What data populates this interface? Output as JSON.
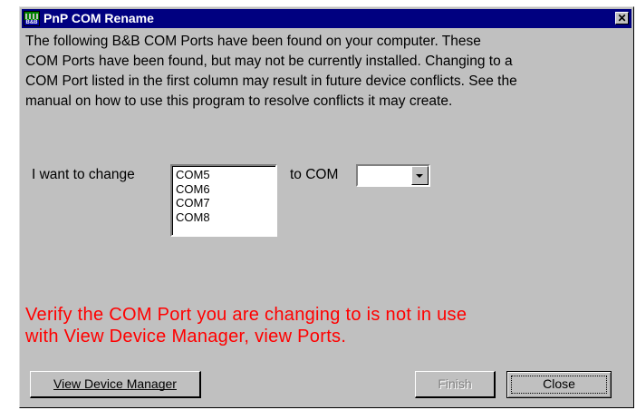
{
  "window": {
    "title": "PnP COM Rename",
    "app_icon": "bb-board-icon",
    "app_icon_badge": "B&B",
    "close_glyph": "✕"
  },
  "intro_text": "The following B&B COM Ports have been found on your computer.  These\nCOM Ports have been found, but may not be currently installed.  Changing to a\nCOM Port listed in the first column may result in future device conflicts.  See the\nmanual on how to use this program to resolve conflicts it may create.",
  "change_label": "I want to change",
  "ports": [
    "COM5",
    "COM6",
    "COM7",
    "COM8"
  ],
  "to_label": "to COM",
  "to_com_value": "",
  "warning_text": "Verify the COM Port you are changing to is not in use\nwith View Device Manager, view Ports.",
  "buttons": {
    "view_device_manager": "View Device Manager",
    "finish": "Finish",
    "close": "Close"
  },
  "colors": {
    "title_bar": "#000080",
    "dialog_face": "#c0c0c0",
    "warning": "#ff0000"
  }
}
